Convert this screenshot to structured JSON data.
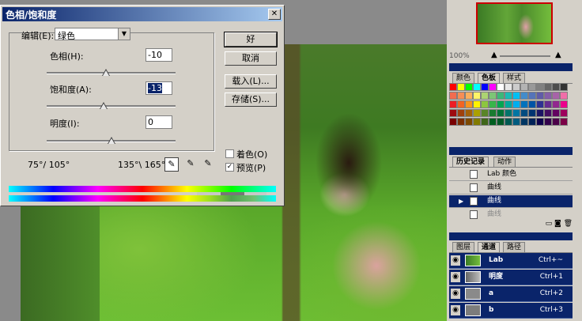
{
  "dialog": {
    "title": "色相/饱和度",
    "close_glyph": "✕",
    "edit_label": "编辑(E):",
    "edit_value": "绿色",
    "hue_label": "色相(H):",
    "hue_value": "-10",
    "saturation_label": "饱和度(A):",
    "saturation_value": "-13",
    "lightness_label": "明度(I):",
    "lightness_value": "0",
    "ok": "好",
    "cancel": "取消",
    "load": "载入(L)...",
    "save": "存储(S)...",
    "colorize_label": "着色(O)",
    "colorize_checked": false,
    "preview_label": "预览(P)",
    "preview_checked": true,
    "range_left": "75°/ 105°",
    "range_right": "135°\\ 165°",
    "hue_slider_level": 0.46,
    "saturation_slider_level": 0.44,
    "lightness_slider_level": 0.5
  },
  "navigator": {
    "zoom": "100%"
  },
  "swatch_panel": {
    "tabs": [
      "颜色",
      "色板",
      "样式"
    ],
    "active_tab": 1,
    "rows": [
      [
        "#ff0000",
        "#ffff00",
        "#00ff00",
        "#00ffff",
        "#0000ff",
        "#ff00ff",
        "#ffffff",
        "#e6e6e6",
        "#cccccc",
        "#b3b3b3",
        "#999999",
        "#808080",
        "#666666",
        "#4d4d4d",
        "#333333"
      ],
      [
        "#f26c4f",
        "#f68e55",
        "#fbaf5c",
        "#fff467",
        "#acd372",
        "#7cc576",
        "#3bb878",
        "#1abbb4",
        "#00bff3",
        "#438ccb",
        "#5574b9",
        "#605ca8",
        "#855fa8",
        "#a763a8",
        "#f06ea9"
      ],
      [
        "#ed1c24",
        "#f26522",
        "#f7941d",
        "#fff200",
        "#8dc63f",
        "#39b54a",
        "#00a651",
        "#00a99d",
        "#00aeef",
        "#0072bc",
        "#0054a6",
        "#2e3192",
        "#662d91",
        "#92278f",
        "#ec008c"
      ],
      [
        "#9e0b0f",
        "#a0410d",
        "#a3620a",
        "#aba000",
        "#598527",
        "#1a7b30",
        "#007236",
        "#00746b",
        "#0076a3",
        "#004b80",
        "#003471",
        "#1b1464",
        "#440e62",
        "#630460",
        "#9e005d"
      ],
      [
        "#790000",
        "#7b2e00",
        "#7d4900",
        "#827b00",
        "#406618",
        "#005e20",
        "#005826",
        "#005952",
        "#005b7f",
        "#003663",
        "#002157",
        "#0d004c",
        "#32004b",
        "#4b0049",
        "#7b0046"
      ]
    ]
  },
  "history_panel": {
    "tabs": [
      "历史记录",
      "动作"
    ],
    "active_tab": 0,
    "items": [
      {
        "label": "Lab 颜色",
        "selected": false
      },
      {
        "label": "曲线",
        "selected": false
      },
      {
        "label": "曲线",
        "selected": true
      },
      {
        "label": "曲线",
        "selected": false
      }
    ]
  },
  "channels_panel": {
    "tabs": [
      "图层",
      "通道",
      "路径"
    ],
    "active_tab": 1,
    "channels": [
      {
        "name": "Lab",
        "shortcut": "Ctrl+~"
      },
      {
        "name": "明度",
        "shortcut": "Ctrl+1"
      },
      {
        "name": "a",
        "shortcut": "Ctrl+2"
      },
      {
        "name": "b",
        "shortcut": "Ctrl+3"
      }
    ]
  }
}
